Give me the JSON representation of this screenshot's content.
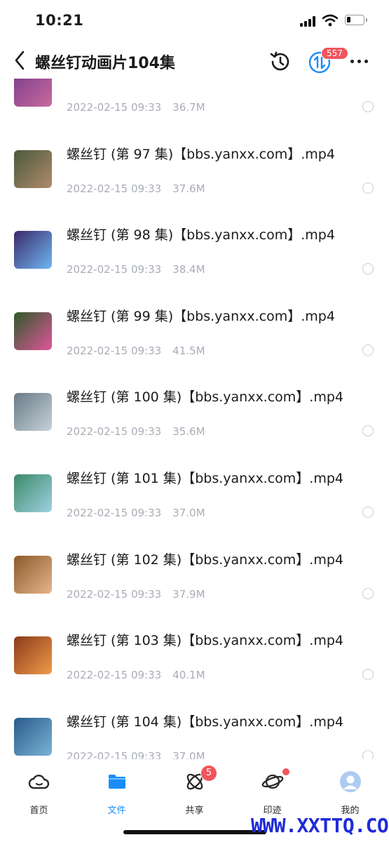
{
  "status_bar": {
    "time": "10:21"
  },
  "header": {
    "title": "螺丝钉动画片104集",
    "transfer_badge": "557"
  },
  "files": [
    {
      "name": "",
      "date": "2022-02-15 09:33",
      "size": "36.7M",
      "thumb_colors": [
        "#7a3c8a",
        "#c76a9e"
      ]
    },
    {
      "name": "螺丝钉 (第 97 集)【bbs.yanxx.com】.mp4",
      "date": "2022-02-15 09:33",
      "size": "37.6M",
      "thumb_colors": [
        "#4a5a3c",
        "#b08a6a"
      ]
    },
    {
      "name": "螺丝钉 (第 98 集)【bbs.yanxx.com】.mp4",
      "date": "2022-02-15 09:33",
      "size": "38.4M",
      "thumb_colors": [
        "#3a2a6a",
        "#6fb7f2"
      ]
    },
    {
      "name": "螺丝钉 (第 99 集)【bbs.yanxx.com】.mp4",
      "date": "2022-02-15 09:33",
      "size": "41.5M",
      "thumb_colors": [
        "#2f5a2a",
        "#e0559a"
      ]
    },
    {
      "name": "螺丝钉 (第 100 集)【bbs.yanxx.com】.mp4",
      "date": "2022-02-15 09:33",
      "size": "35.6M",
      "thumb_colors": [
        "#6a7a86",
        "#c6d2da"
      ]
    },
    {
      "name": "螺丝钉 (第 101 集)【bbs.yanxx.com】.mp4",
      "date": "2022-02-15 09:33",
      "size": "37.0M",
      "thumb_colors": [
        "#3a8a6a",
        "#9fd0e0"
      ]
    },
    {
      "name": "螺丝钉 (第 102 集)【bbs.yanxx.com】.mp4",
      "date": "2022-02-15 09:33",
      "size": "37.9M",
      "thumb_colors": [
        "#8a5a2a",
        "#e6b48c"
      ]
    },
    {
      "name": "螺丝钉 (第 103 集)【bbs.yanxx.com】.mp4",
      "date": "2022-02-15 09:33",
      "size": "40.1M",
      "thumb_colors": [
        "#8a3a1a",
        "#f09a4a"
      ]
    },
    {
      "name": "螺丝钉 (第 104 集)【bbs.yanxx.com】.mp4",
      "date": "2022-02-15 09:33",
      "size": "37.0M",
      "thumb_colors": [
        "#2a5a8a",
        "#7ab4d6"
      ]
    }
  ],
  "tabs": [
    {
      "label": "首页",
      "icon": "cloud-icon"
    },
    {
      "label": "文件",
      "icon": "folder-icon",
      "active": true
    },
    {
      "label": "共享",
      "icon": "share-orbit-icon",
      "badge": "5"
    },
    {
      "label": "印迹",
      "icon": "planet-icon",
      "dot": true
    },
    {
      "label": "我的",
      "icon": "avatar-icon"
    }
  ],
  "colors": {
    "accent": "#1a8cf7",
    "badge": "#f2545b",
    "meta": "#a9adb6"
  },
  "watermark": "WWW.XXTTQ.COM"
}
